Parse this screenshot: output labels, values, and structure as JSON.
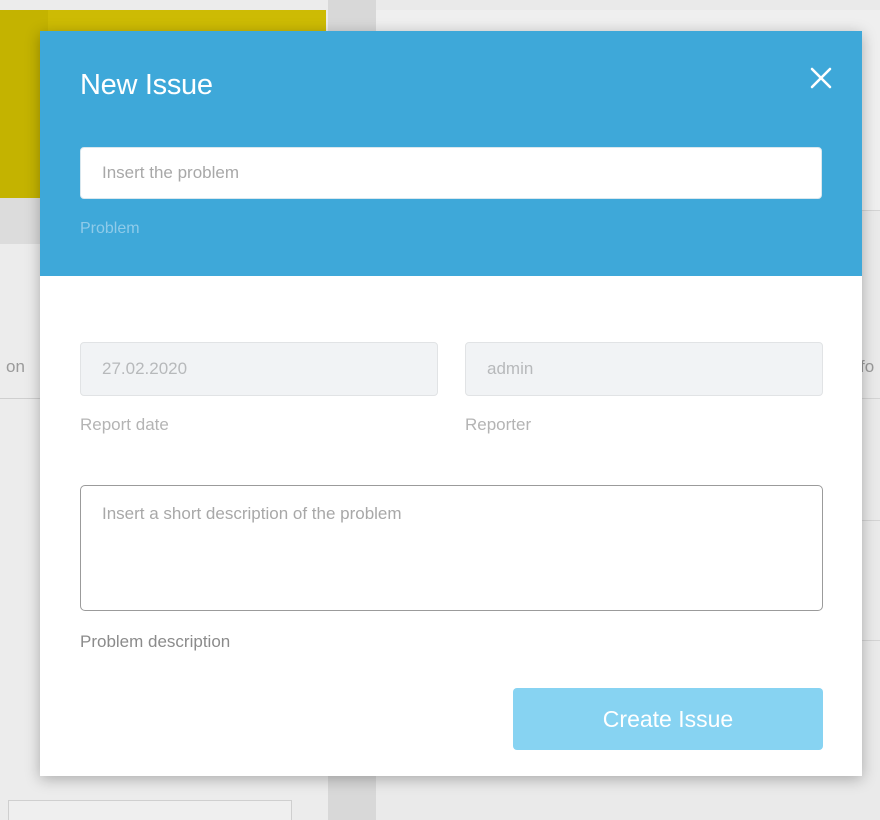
{
  "modal": {
    "title": "New Issue",
    "close_icon": "close-icon",
    "problem": {
      "placeholder": "Insert the problem",
      "value": "",
      "label": "Problem"
    },
    "report_date": {
      "value": "27.02.2020",
      "label": "Report date"
    },
    "reporter": {
      "value": "admin",
      "label": "Reporter"
    },
    "description": {
      "placeholder": "Insert a short description of the problem",
      "value": "",
      "label": "Problem description"
    },
    "create_button_label": "Create Issue"
  },
  "background": {
    "left_fragment": "on",
    "right_fragment": "fo"
  },
  "colors": {
    "header": "#3ea8d9",
    "button": "#87d3f2",
    "background_accent": "#c4b300"
  }
}
